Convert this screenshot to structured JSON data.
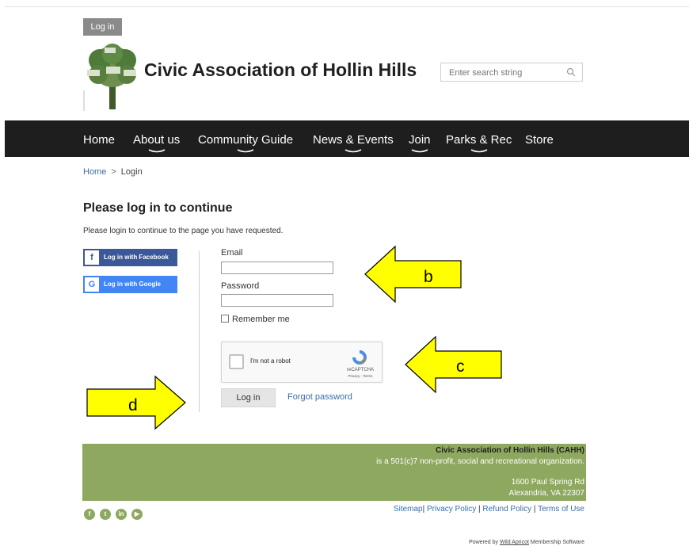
{
  "header": {
    "login_button": "Log in",
    "site_title": "Civic Association of Hollin Hills",
    "search_placeholder": "Enter search string"
  },
  "nav": {
    "items": [
      "Home",
      "About us",
      "Community Guide",
      "News & Events",
      "Join",
      "Parks & Rec",
      "Store"
    ]
  },
  "breadcrumb": {
    "home": "Home",
    "separator": ">",
    "current": "Login"
  },
  "login": {
    "title": "Please log in to continue",
    "subtitle": "Please login to continue to the page you have requested.",
    "facebook_label": "Log in with Facebook",
    "google_label": "Log in with Google",
    "email_label": "Email",
    "email_value": "",
    "password_label": "Password",
    "password_value": "",
    "remember_label": "Remember me",
    "captcha_text": "I'm not a robot",
    "captcha_brand": "reCAPTCHA",
    "captcha_links": "Privacy - Terms",
    "submit_label": "Log in",
    "forgot_label": "Forgot password"
  },
  "annotations": {
    "b": "b",
    "c": "c",
    "d": "d",
    "arrow_color": "#ffff00"
  },
  "footer": {
    "org_name": "Civic Association of Hollin Hills (CAHH)",
    "org_desc": "is a 501(c)7 non-profit, social and recreational organization.",
    "address1": "1600 Paul Spring Rd",
    "address2": "Alexandria, VA 22307",
    "links": [
      "Sitemap",
      "Privacy Policy",
      "Refund Policy",
      "Terms of Use"
    ],
    "social_icons": [
      "facebook-icon",
      "twitter-icon",
      "linkedin-icon",
      "youtube-icon"
    ],
    "powered_prefix": "Powered by",
    "powered_link": "Wild Apricot",
    "powered_suffix": "Membership Software"
  },
  "colors": {
    "nav_bg": "#1e1e1e",
    "footer_green": "#8ea85f",
    "link_blue": "#3a6ea5",
    "facebook_blue": "#3b5998",
    "google_blue": "#4285f4"
  }
}
